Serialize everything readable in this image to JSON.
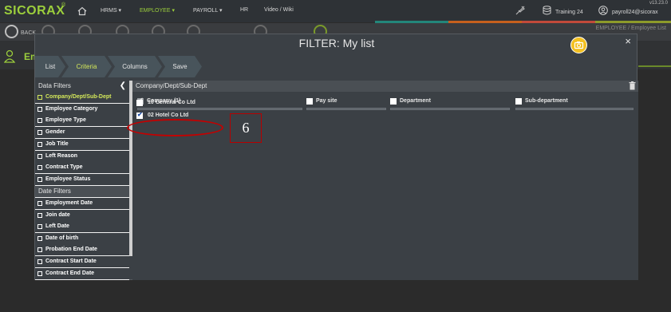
{
  "app": {
    "brand": "SICORAX",
    "brand_mark": "®",
    "version": "v13.23.0",
    "nav": [
      "HRMS ▾",
      "EMPLOYEE ▾",
      "PAYROLL ▾",
      "HR",
      "Video / Wiki"
    ],
    "active_nav_index": 1,
    "training": "Training 24",
    "user": "payroll24@sicorax",
    "accent": "#9ccf3c"
  },
  "background": {
    "back_label": "BACK",
    "breadcrumb": "EMPLOYEE /  Employee List",
    "page_title": "Em"
  },
  "modal": {
    "title": "FILTER: My list",
    "close": "×",
    "steps": [
      "List",
      "Criteria",
      "Columns",
      "Save"
    ],
    "active_step": 1
  },
  "filters": {
    "header": "Data Filters",
    "collapse": "❮",
    "data_items": [
      "Company/Dept/Sub-Dept",
      "Employee Category",
      "Employee Type",
      "Gender",
      "Job Title",
      "Left Reason",
      "Contract Type",
      "Employee Status"
    ],
    "selected_index": 0,
    "date_header": "Date Filters",
    "date_items": [
      "Employment Date",
      "Join date",
      "Left Date",
      "Date of birth",
      "Probation End Date",
      "Contract Start Date",
      "Contract End Date"
    ]
  },
  "content": {
    "header": "Company/Dept/Sub-Dept",
    "columns": [
      {
        "label": "Company (1)",
        "checked": true,
        "disabled": true
      },
      {
        "label": "Pay site",
        "checked": false
      },
      {
        "label": "Department",
        "checked": false
      },
      {
        "label": "Sub-department",
        "checked": false
      }
    ],
    "options": [
      {
        "label": "10 General Co Ltd",
        "checked": false
      },
      {
        "label": "02 Hotel Co Ltd",
        "checked": true
      }
    ]
  },
  "annotation": {
    "step_number": "6",
    "highlight_color": "#c40000"
  }
}
